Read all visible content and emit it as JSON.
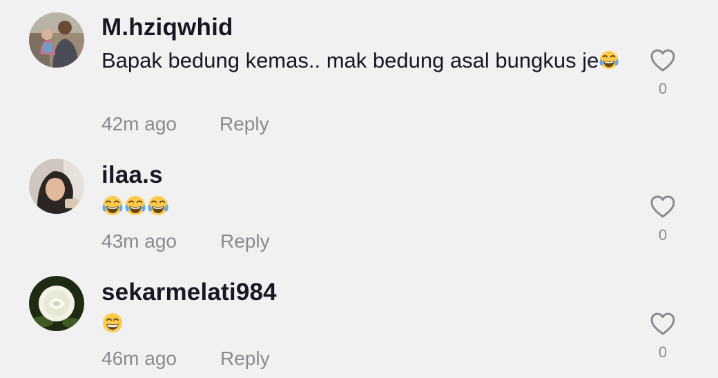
{
  "comments": [
    {
      "username": "M.hziqwhid",
      "text": "Bapak bedung kemas.. mak bedung asal bungkus je",
      "emojis": [
        "face-with-tears-of-joy"
      ],
      "time": "42m ago",
      "reply_label": "Reply",
      "likes": "0"
    },
    {
      "username": "ilaa.s",
      "text": "",
      "emojis": [
        "face-with-tears-of-joy",
        "face-with-tears-of-joy",
        "face-with-tears-of-joy"
      ],
      "time": "43m ago",
      "reply_label": "Reply",
      "likes": "0"
    },
    {
      "username": "sekarmelati984",
      "text": "",
      "emojis": [
        "beaming-face"
      ],
      "time": "46m ago",
      "reply_label": "Reply",
      "likes": "0"
    }
  ],
  "colors": {
    "background": "#f1f1f2",
    "username": "#161823",
    "meta": "#8a8b91"
  }
}
